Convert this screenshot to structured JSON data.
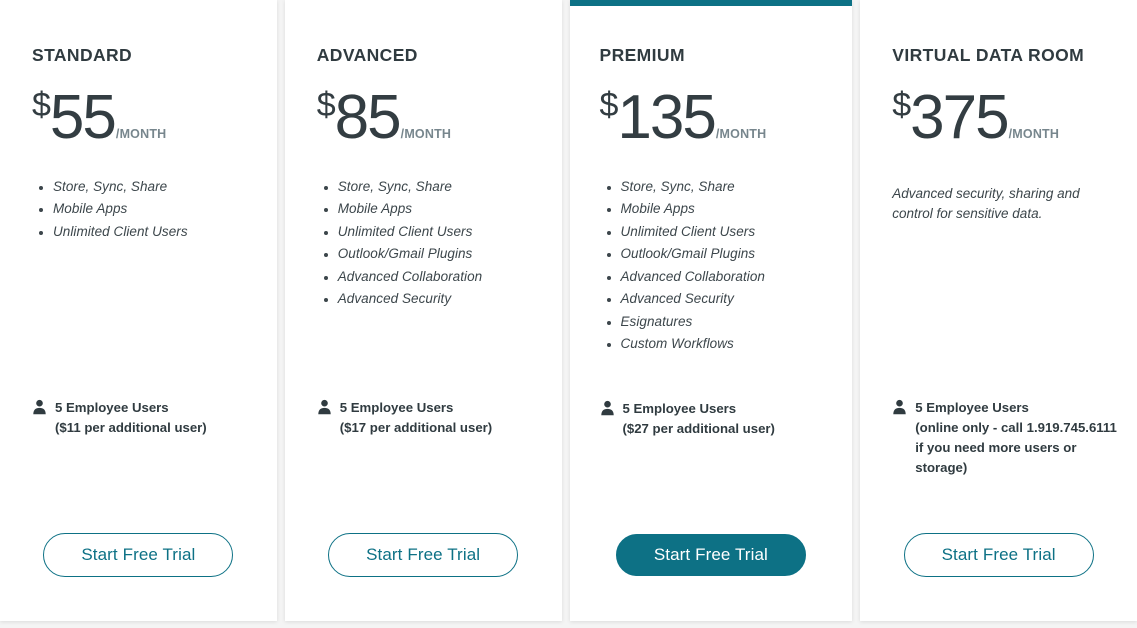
{
  "theme": {
    "accent": "#0d7185",
    "text_dark": "#303b40",
    "text_muted": "#77868d",
    "card_bg": "#ffffff",
    "page_bg": "#f4f4f4"
  },
  "plans": [
    {
      "id": "standard",
      "name": "STANDARD",
      "currency": "$",
      "amount": "55",
      "period": "/MONTH",
      "featured": false,
      "features": [
        "Store, Sync, Share",
        "Mobile Apps",
        "Unlimited Client Users"
      ],
      "blurb": "",
      "users_line1": "5 Employee Users",
      "users_line2": "($11 per additional user)",
      "cta_label": "Start Free Trial"
    },
    {
      "id": "advanced",
      "name": "ADVANCED",
      "currency": "$",
      "amount": "85",
      "period": "/MONTH",
      "featured": false,
      "features": [
        "Store, Sync, Share",
        "Mobile Apps",
        "Unlimited Client Users",
        "Outlook/Gmail Plugins",
        "Advanced Collaboration",
        "Advanced Security"
      ],
      "blurb": "",
      "users_line1": "5 Employee Users",
      "users_line2": "($17 per additional user)",
      "cta_label": "Start Free Trial"
    },
    {
      "id": "premium",
      "name": "PREMIUM",
      "currency": "$",
      "amount": "135",
      "period": "/MONTH",
      "featured": true,
      "features": [
        "Store, Sync, Share",
        "Mobile Apps",
        "Unlimited Client Users",
        "Outlook/Gmail Plugins",
        "Advanced Collaboration",
        "Advanced Security",
        "Esignatures",
        "Custom Workflows"
      ],
      "blurb": "",
      "users_line1": "5 Employee Users",
      "users_line2": "($27 per additional user)",
      "cta_label": "Start Free Trial"
    },
    {
      "id": "virtual-data-room",
      "name": "VIRTUAL DATA ROOM",
      "currency": "$",
      "amount": "375",
      "period": "/MONTH",
      "featured": false,
      "features": [],
      "blurb": "Advanced security, sharing and control for sensitive data.",
      "users_line1": "5 Employee Users",
      "users_line2": "(online only - call 1.919.745.6111\n        if you need more users or\nstorage)",
      "cta_label": "Start Free Trial"
    }
  ]
}
